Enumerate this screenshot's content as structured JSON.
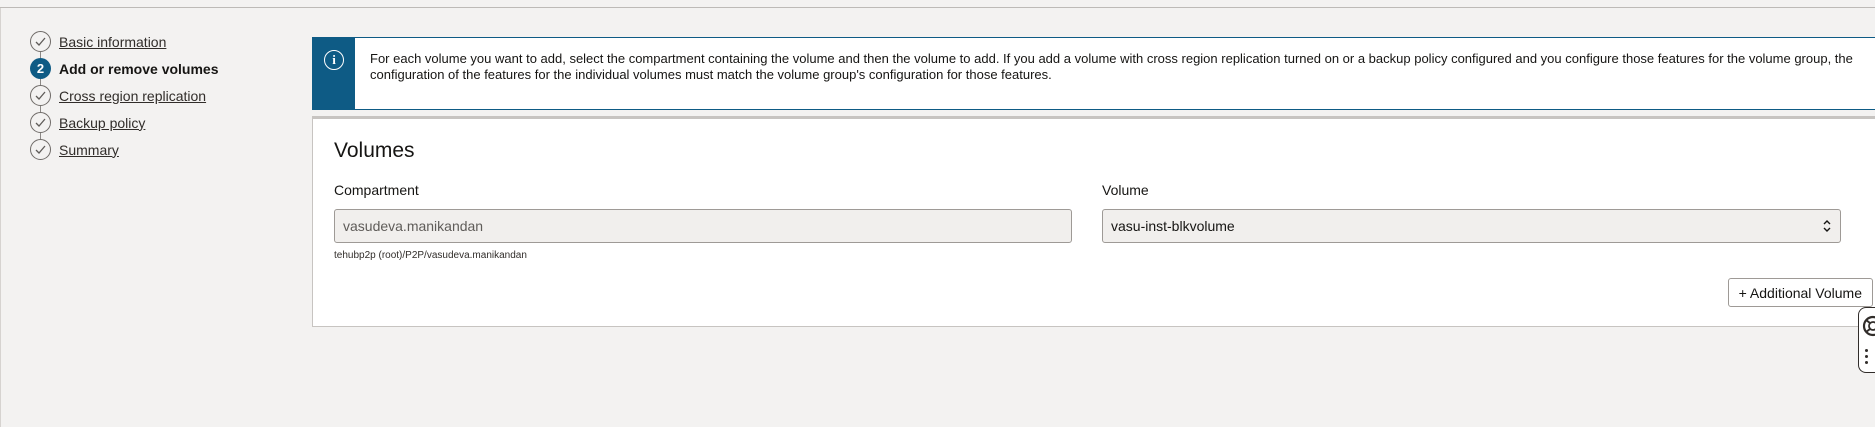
{
  "steps": [
    {
      "label": "Basic information",
      "state": "done"
    },
    {
      "label": "Add or remove volumes",
      "state": "current",
      "number": "2"
    },
    {
      "label": "Cross region replication",
      "state": "done"
    },
    {
      "label": "Backup policy",
      "state": "done"
    },
    {
      "label": "Summary",
      "state": "done"
    }
  ],
  "info": {
    "icon": "info-icon",
    "glyph": "i",
    "text": "For each volume you want to add, select the compartment containing the volume and then the volume to add. If you add a volume with cross region replication turned on or a backup policy configured and you configure those features for the volume group, the configuration of the features for the individual volumes must match the volume group's configuration for those features."
  },
  "volumes": {
    "title": "Volumes",
    "compartment": {
      "label": "Compartment",
      "value": "vasudeva.manikandan",
      "path": "tehubp2p (root)/P2P/vasudeva.manikandan"
    },
    "volume": {
      "label": "Volume",
      "value": "vasu-inst-blkvolume"
    },
    "add_button": "+ Additional Volume"
  },
  "colors": {
    "accent": "#0e5b85",
    "background": "#f3f2f1"
  }
}
